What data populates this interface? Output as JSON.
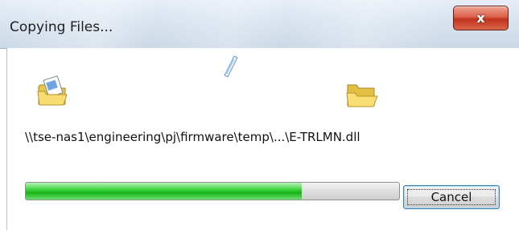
{
  "window": {
    "title": "Copying Files...",
    "close_label": "x"
  },
  "copy": {
    "source_icon": "folder-with-document-icon",
    "destination_icon": "open-folder-icon",
    "flying_icon": "flying-document-icon",
    "path": "\\\\tse-nas1\\engineering\\pj\\firmware\\temp\\...\\E-TRLMN.dll",
    "progress_fraction": 0.74
  },
  "buttons": {
    "cancel_label": "Cancel"
  },
  "colors": {
    "progress_green": "#18b318",
    "close_red": "#c0331d",
    "button_focus_blue": "#3c7fb1"
  }
}
